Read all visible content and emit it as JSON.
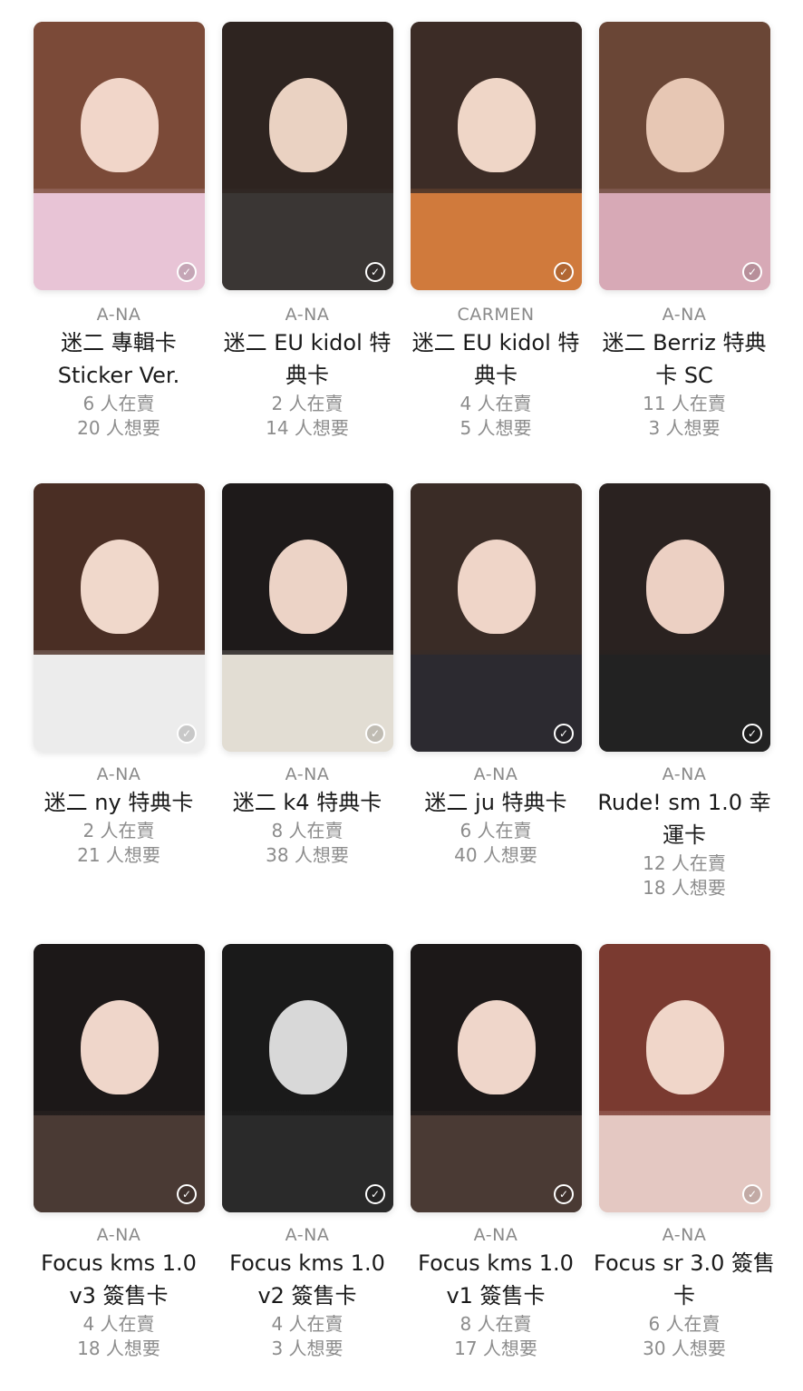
{
  "colors": {
    "meta": "#8c8c8c",
    "title": "#1a1a1a",
    "background": "#ffffff"
  },
  "check_icon": "check-circle-icon",
  "cards": [
    {
      "group": "A-NA",
      "title": "迷二 專輯卡 Sticker Ver.",
      "selling": "6 人在賣",
      "wanting": "20 人想要",
      "palette": [
        "#7b4a38",
        "#f1d6c9",
        "#e8c4d6"
      ]
    },
    {
      "group": "A-NA",
      "title": "迷二 EU kidol 特典卡",
      "selling": "2 人在賣",
      "wanting": "14 人想要",
      "palette": [
        "#2e2420",
        "#ead2c2",
        "#3a3634"
      ]
    },
    {
      "group": "CARMEN",
      "title": "迷二 EU kidol 特典卡",
      "selling": "4 人在賣",
      "wanting": "5 人想要",
      "palette": [
        "#3c2c26",
        "#efd6c7",
        "#d07a3c"
      ]
    },
    {
      "group": "A-NA",
      "title": "迷二 Berriz 特典卡 SC",
      "selling": "11 人在賣",
      "wanting": "3 人想要",
      "palette": [
        "#6a4636",
        "#e7c7b4",
        "#d7a9b6"
      ]
    },
    {
      "group": "A-NA",
      "title": "迷二 ny 特典卡",
      "selling": "2 人在賣",
      "wanting": "21 人想要",
      "palette": [
        "#4a2e24",
        "#f0d8cb",
        "#ececec"
      ]
    },
    {
      "group": "A-NA",
      "title": "迷二 k4 特典卡",
      "selling": "8 人在賣",
      "wanting": "38 人想要",
      "palette": [
        "#1e1a1a",
        "#ecd3c6",
        "#e2ddd3"
      ]
    },
    {
      "group": "A-NA",
      "title": "迷二 ju 特典卡",
      "selling": "6 人在賣",
      "wanting": "40 人想要",
      "palette": [
        "#3a2c26",
        "#efd5c8",
        "#2c2a30"
      ]
    },
    {
      "group": "A-NA",
      "title": "Rude! sm 1.0 幸運卡",
      "selling": "12 人在賣",
      "wanting": "18 人想要",
      "palette": [
        "#2a2220",
        "#ecd0c3",
        "#222222"
      ]
    },
    {
      "group": "A-NA",
      "title": "Focus kms 1.0 v3 簽售卡",
      "selling": "4 人在賣",
      "wanting": "18 人想要",
      "palette": [
        "#1c1818",
        "#efd6ca",
        "#4a3a34"
      ]
    },
    {
      "group": "A-NA",
      "title": "Focus kms 1.0 v2 簽售卡",
      "selling": "4 人在賣",
      "wanting": "3 人想要",
      "palette": [
        "#1a1a1a",
        "#d8d8d8",
        "#2a2a2a"
      ]
    },
    {
      "group": "A-NA",
      "title": "Focus kms 1.0 v1 簽售卡",
      "selling": "8 人在賣",
      "wanting": "17 人想要",
      "palette": [
        "#1c1818",
        "#efd6ca",
        "#4a3a34"
      ]
    },
    {
      "group": "A-NA",
      "title": "Focus sr 3.0 簽售卡",
      "selling": "6 人在賣",
      "wanting": "30 人想要",
      "palette": [
        "#7a3a30",
        "#f0d6c9",
        "#e4c8c2"
      ]
    }
  ]
}
